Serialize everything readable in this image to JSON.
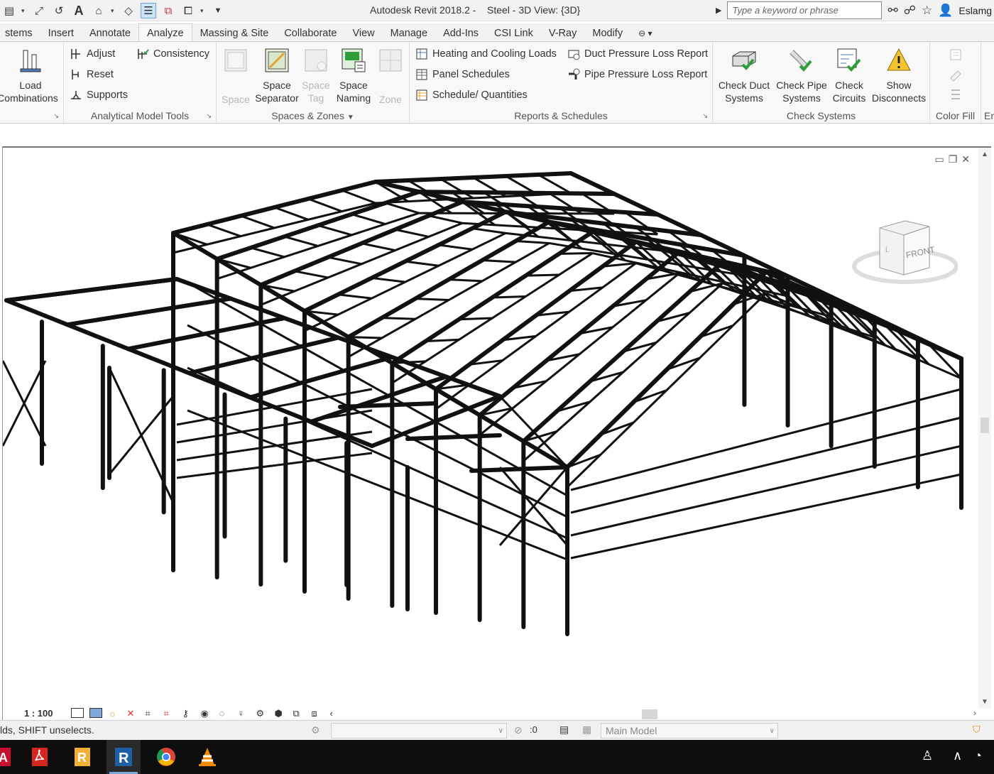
{
  "titlebar": {
    "title": "Autodesk Revit 2018.2 -    Steel - 3D View: {3D}",
    "search_placeholder": "Type a keyword or phrase",
    "user": "Eslamg",
    "qat_icons": [
      "open-icon",
      "measure-icon",
      "dimension-icon",
      "text-icon",
      "view-3d-icon",
      "sync-icon",
      "thin-lines-icon",
      "close-hidden-icon",
      "switch-windows-icon",
      "customize-icon"
    ]
  },
  "tabs": [
    "stems",
    "Insert",
    "Annotate",
    "Analyze",
    "Massing & Site",
    "Collaborate",
    "View",
    "Manage",
    "Add-Ins",
    "CSI Link",
    "V-Ray",
    "Modify"
  ],
  "active_tab": "Analyze",
  "ribbon": {
    "load_combinations": {
      "line1": "Load",
      "line2": "Combinations"
    },
    "analytical_tools": {
      "adjust": "Adjust",
      "reset": "Reset",
      "supports": "Supports",
      "consistency": "Consistency",
      "title": "Analytical Model Tools"
    },
    "spaces": {
      "space": "Space",
      "space_separator": {
        "line1": "Space",
        "line2": "Separator"
      },
      "space_tag": {
        "line1": "Space",
        "line2": "Tag"
      },
      "space_naming": {
        "line1": "Space",
        "line2": "Naming"
      },
      "zone": "Zone",
      "title": "Spaces & Zones"
    },
    "reports": {
      "heating_cooling": "Heating and  Cooling Loads",
      "panel_schedules": "Panel  Schedules",
      "schedule_quantities": "Schedule/  Quantities",
      "duct_pressure": "Duct Pressure  Loss Report",
      "pipe_pressure": "Pipe Pressure  Loss Report",
      "title": "Reports & Schedules"
    },
    "check": {
      "duct": {
        "line1": "Check Duct",
        "line2": "Systems"
      },
      "pipe": {
        "line1": "Check Pipe",
        "line2": "Systems"
      },
      "circuits": {
        "line1": "Check",
        "line2": "Circuits"
      },
      "disconnects": {
        "line1": "Show",
        "line2": "Disconnects"
      },
      "title": "Check Systems"
    },
    "color_fill": {
      "title": "Color Fill",
      "next": "En"
    }
  },
  "viewcube": {
    "face": "FRONT"
  },
  "view_control": {
    "scale": "1 : 100"
  },
  "status": {
    "text": "lds, SHIFT unselects.",
    "select_count": ":0",
    "model": "Main Model"
  },
  "taskbar": {
    "apps": [
      "autocad-icon",
      "acrobat-icon",
      "revit-orange-icon",
      "revit-icon",
      "chrome-icon",
      "vlc-icon"
    ],
    "running_index": 3
  },
  "colors": {
    "accent": "#6ea3d8",
    "check_green": "#2e9e3a",
    "taskbar": "#0e0e0e"
  }
}
